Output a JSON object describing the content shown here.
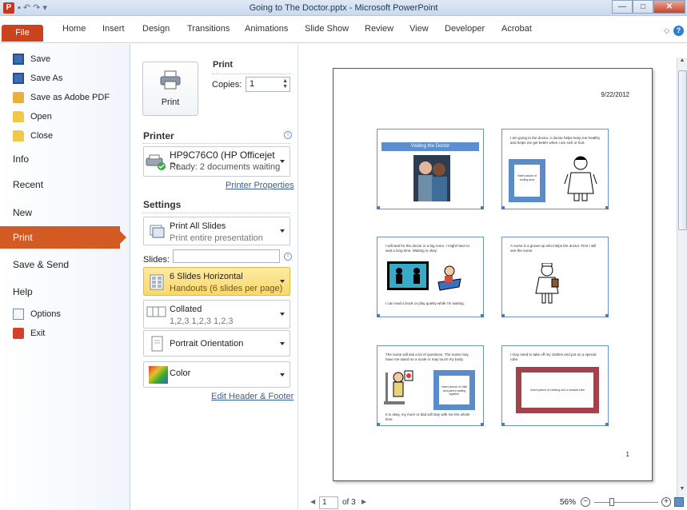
{
  "window": {
    "title": "Going to The Doctor.pptx - Microsoft PowerPoint",
    "app_icon": "P",
    "minimize": "—",
    "maximize": "□",
    "close": "✕"
  },
  "ribbon": {
    "file_tab": "File",
    "tabs": [
      "Home",
      "Insert",
      "Design",
      "Transitions",
      "Animations",
      "Slide Show",
      "Review",
      "View",
      "Developer",
      "Acrobat"
    ]
  },
  "nav": {
    "small_items": [
      {
        "label": "Save",
        "icon": "save-icon"
      },
      {
        "label": "Save As",
        "icon": "save-as-icon"
      },
      {
        "label": "Save as Adobe PDF",
        "icon": "adobe-pdf-icon"
      },
      {
        "label": "Open",
        "icon": "open-folder-icon"
      },
      {
        "label": "Close",
        "icon": "close-folder-icon"
      }
    ],
    "info": "Info",
    "recent": "Recent",
    "new": "New",
    "print": "Print",
    "save_send": "Save & Send",
    "help": "Help",
    "options": "Options",
    "exit": "Exit"
  },
  "print_panel": {
    "print_button": "Print",
    "print_header": "Print",
    "copies_label": "Copies:",
    "copies_value": "1",
    "printer_header": "Printer",
    "printer_name": "HP9C76C0 (HP Officejet Pr...",
    "printer_status": "Ready: 2 documents waiting",
    "printer_properties": "Printer Properties",
    "settings_header": "Settings",
    "slides_range_title": "Print All Slides",
    "slides_range_sub": "Print entire presentation",
    "slides_label": "Slides:",
    "slides_value": "",
    "layout_title": "6 Slides Horizontal",
    "layout_sub": "Handouts (6 slides per page)",
    "collation_title": "Collated",
    "collation_sub": "1,2,3   1,2,3   1,2,3",
    "orientation": "Portrait Orientation",
    "color": "Color",
    "edit_header_footer": "Edit Header & Footer"
  },
  "preview": {
    "date": "9/22/2012",
    "page_number": "1",
    "slides": [
      {
        "title": "Visiting the Doctor"
      },
      {
        "text": "I am going to the doctor. A doctor helps keep me healthy and helps me get better when I am sick or hurt.",
        "box_text": "Insert picture of visiting area"
      },
      {
        "text": "I will wait for the doctor in a big room. I might have to wait a long time. Waiting is okay.",
        "text_bottom": "I can read a book or play quietly while I'm waiting."
      },
      {
        "text": "A nurse is a grown-up who helps the doctor. First I will see the nurse."
      },
      {
        "text": "The nurse will ask a lot of questions. The nurse may have me stand on a scale or may touch my body.",
        "box_text": "Insert picture of child and parent waiting together",
        "text_bottom": "It is okay, my mom or dad will stay with me the whole time."
      },
      {
        "text": "I may need to take off my clothes and put on a special robe.",
        "box_text": "Insert picture of clothing and a medical robe"
      }
    ]
  },
  "page_nav": {
    "current_page": "1",
    "of_total": "of 3"
  },
  "zoom": {
    "percent": "56%",
    "minus": "−",
    "plus": "+"
  }
}
